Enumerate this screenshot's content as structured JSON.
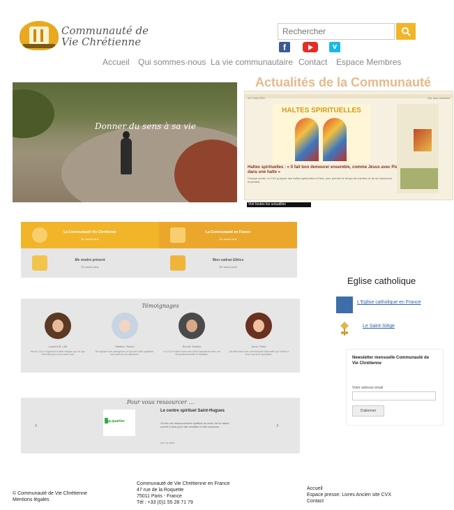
{
  "header": {
    "logo_line1": "Communauté de",
    "logo_line2": "Vie Chrétienne",
    "search_placeholder": "Rechercher",
    "social": {
      "facebook": "f",
      "vimeo": "v"
    }
  },
  "nav": {
    "items": [
      "Accueil",
      "Qui sommes-nous",
      "La vie communautaire",
      "Contact",
      "Espace Membres"
    ]
  },
  "hero": {
    "caption": "Donner du sens à sa vie"
  },
  "actualites": {
    "title": "Actualités de la Communauté",
    "bar_left": "ACTUALITÉS",
    "bar_right": "Voir plus d'articles",
    "panel_title": "HALTES SPIRITUELLES",
    "headline": "Haltes spirituelles : « Il fait bon demeurer ensemble, comme Jésus avec Pierre dans une halte »",
    "snippet": "Chaque année, la CVX propose des haltes spirituelles à Paris, pour prendre le temps de s'arrêter et de se ressourcer ensemble.",
    "more": "Voir toutes les actualités"
  },
  "tiles": {
    "t1": {
      "label": "La Communauté Vie Chrétienne",
      "sub": "En savoir plus"
    },
    "t2": {
      "label": "La Communauté en France",
      "sub": "En savoir plus"
    },
    "t3": {
      "label": "Me rendre présent",
      "sub": "En savoir plus"
    },
    "t4": {
      "label": "Mon cadran Ethics",
      "sub": "En savoir plus"
    }
  },
  "temoignages": {
    "title": "Témoignages",
    "people": [
      {
        "name": "Laurent M. Lille",
        "text": "Ma vie CVX m'apprend à relire chaque jour ce que Dieu fait pour moi et avec moi."
      },
      {
        "name": "Martine, Rouen",
        "text": "En équipe nous partageons ce qui fait notre quotidien, nos joies et nos questions."
      },
      {
        "name": "Benoît, Nantes",
        "text": "La CVX m'aide à faire des choix importants dans ma vie professionnelle et familiale."
      },
      {
        "name": "Anne, Paris",
        "text": "J'ai découvert une communauté fraternelle qui m'aide à vivre ma foi au quotidien."
      }
    ]
  },
  "slider": {
    "title": "Pour vous ressourcer ...",
    "logo_text": "sp.quartier",
    "item_title": "Le centre spirituel Saint-Hugues",
    "item_text": "Un lieu de ressourcement spirituel au cœur de la nature, ouvert à tous pour des retraites et des sessions.",
    "item_more": "Lire la suite",
    "prev": "‹",
    "next": "›"
  },
  "sidebar": {
    "title": "Eglise catholique",
    "link1": "L'Eglise catholique en France",
    "link2": "Le Saint-Siège",
    "newsletter_title": "Newsletter mensuelle Communauté de Vie Chrétienne",
    "newsletter_label": "Votre adresse email",
    "newsletter_button": "S'abonner"
  },
  "footer": {
    "copyright": "© Communauté de Vie Chrétienne",
    "mentions": "Mentions légales",
    "addr1": "Communauté de Vie Chrétienne en France",
    "addr2": "47 rue de la Roquette",
    "addr3": "75011 Paris - France",
    "addr4": "Tél : +33 (0)1 55 28 71 79",
    "link1": "Accueil",
    "link2": "Espace presse: Livres Ancien site CVX",
    "link3": "Contact"
  },
  "colors": {
    "accent": "#f2b52a",
    "accent_dark": "#eba72c",
    "grey": "#e6e6e6"
  }
}
